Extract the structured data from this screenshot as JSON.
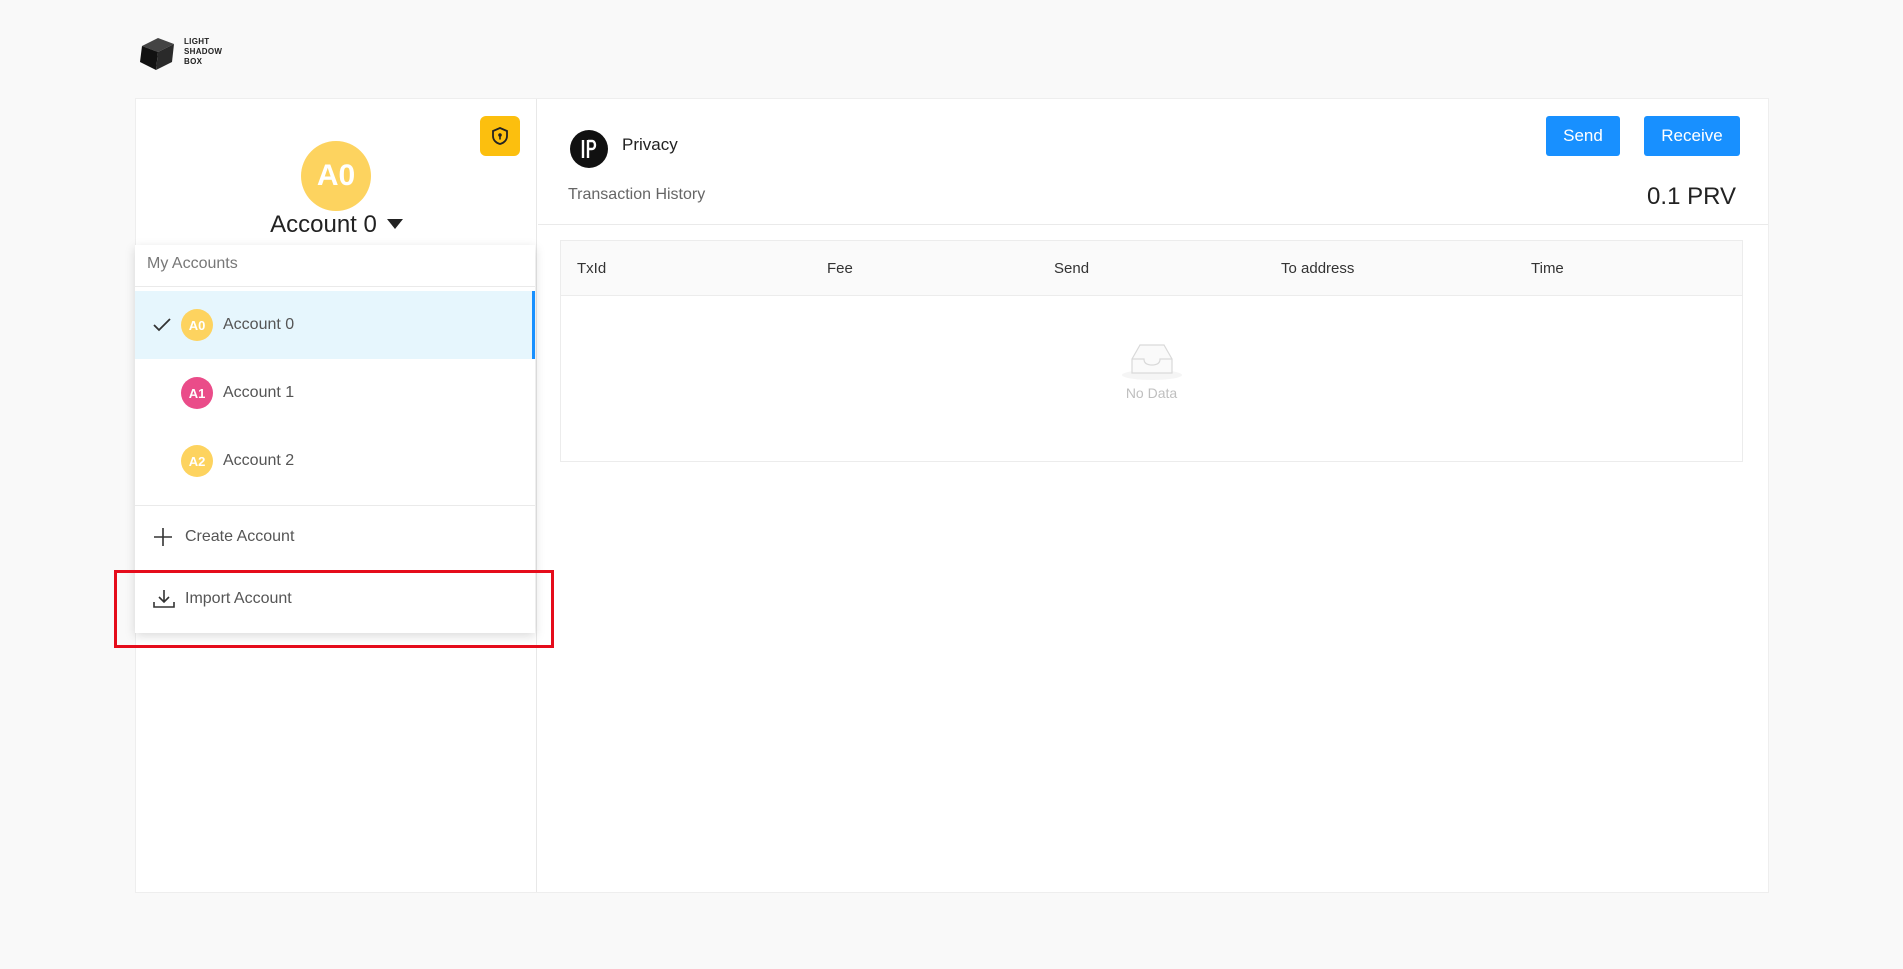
{
  "logo": {
    "line1": "LIGHT",
    "line2": "SHADOW",
    "line3": "BOX"
  },
  "sidebar": {
    "avatar_initials": "A0",
    "current_account": "Account 0"
  },
  "dropdown": {
    "header": "My Accounts",
    "accounts": [
      {
        "initials": "A0",
        "label": "Account 0",
        "color": "#fdd35f",
        "selected": true
      },
      {
        "initials": "A1",
        "label": "Account 1",
        "color": "#ea4c89",
        "selected": false
      },
      {
        "initials": "A2",
        "label": "Account 2",
        "color": "#fdd35f",
        "selected": false
      }
    ],
    "create_label": "Create Account",
    "import_label": "Import Account"
  },
  "coin": {
    "name": "Privacy",
    "icon": "privacy-coin-icon"
  },
  "actions": {
    "send": "Send",
    "receive": "Receive"
  },
  "tx_history_title": "Transaction History",
  "balance": "0.1 PRV",
  "table": {
    "columns": [
      "TxId",
      "Fee",
      "Send",
      "To address",
      "Time"
    ],
    "empty_text": "No Data"
  },
  "colors": {
    "primary": "#1890ff",
    "shield_button": "#fcbf0e",
    "highlight": "#e50c1b"
  }
}
